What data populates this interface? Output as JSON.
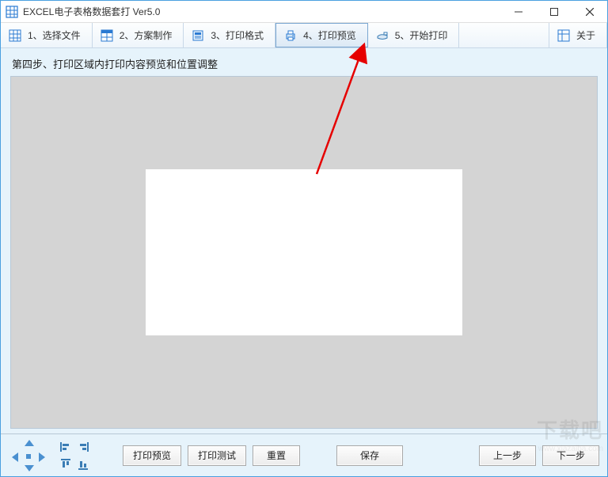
{
  "window": {
    "title": "EXCEL电子表格数据套打 Ver5.0"
  },
  "toolbar": {
    "items": [
      {
        "label": "1、选择文件"
      },
      {
        "label": "2、方案制作"
      },
      {
        "label": "3、打印格式"
      },
      {
        "label": "4、打印预览"
      },
      {
        "label": "5、开始打印"
      },
      {
        "label": "关于"
      }
    ]
  },
  "content": {
    "step_label": "第四步、打印区域内打印内容预览和位置调整"
  },
  "buttons": {
    "print_preview": "打印预览",
    "print_test": "打印测试",
    "reset": "重置",
    "save": "保存",
    "prev": "上一步",
    "next": "下一步"
  },
  "watermark": {
    "text": "下载吧",
    "url": "www.xiazaiba.com"
  }
}
